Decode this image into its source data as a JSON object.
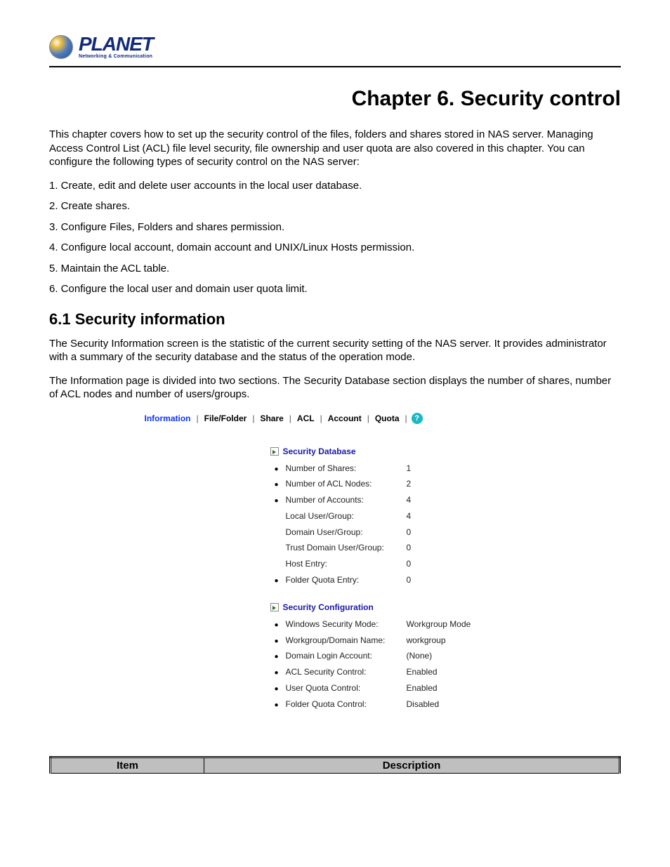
{
  "logo": {
    "brand": "PLANET",
    "tagline": "Networking & Communication"
  },
  "chapter_title": "Chapter 6.  Security control",
  "intro_paragraph": "This chapter covers how to set up the security control of the files, folders and shares stored in NAS server. Managing Access Control List (ACL) file level security, file ownership and user quota are also covered in this chapter. You can configure the following types of security control on the NAS server:",
  "numbered_list": [
    "1. Create, edit and delete user accounts in the local user database.",
    "2. Create shares.",
    "3. Configure Files, Folders and shares permission.",
    "4. Configure local account, domain account and UNIX/Linux Hosts permission.",
    "5. Maintain the ACL table.",
    "6. Configure the local user and domain user quota limit."
  ],
  "section_heading": "6.1 Security information",
  "section_p1": "The Security Information screen is the statistic of the current security setting of the NAS server. It provides administrator with a summary of the security database and the status of the operation mode.",
  "section_p2": "The Information page is divided into two sections. The Security Database section displays the number of shares, number of ACL nodes and number of users/groups.",
  "screenshot": {
    "tabs": [
      "Information",
      "File/Folder",
      "Share",
      "ACL",
      "Account",
      "Quota"
    ],
    "active_tab_index": 0,
    "groups": [
      {
        "title": "Security Database",
        "rows": [
          {
            "bullet": true,
            "key": "Number of Shares:",
            "val": "1"
          },
          {
            "bullet": true,
            "key": "Number of ACL Nodes:",
            "val": "2"
          },
          {
            "bullet": true,
            "key": "Number of Accounts:",
            "val": "4"
          },
          {
            "bullet": false,
            "key": "Local User/Group:",
            "val": "4"
          },
          {
            "bullet": false,
            "key": "Domain User/Group:",
            "val": "0"
          },
          {
            "bullet": false,
            "key": "Trust Domain User/Group:",
            "val": "0"
          },
          {
            "bullet": false,
            "key": "Host Entry:",
            "val": "0"
          },
          {
            "bullet": true,
            "key": "Folder Quota Entry:",
            "val": "0"
          }
        ]
      },
      {
        "title": "Security Configuration",
        "rows": [
          {
            "bullet": true,
            "key": "Windows Security Mode:",
            "val": "Workgroup Mode"
          },
          {
            "bullet": true,
            "key": "Workgroup/Domain Name:",
            "val": "workgroup"
          },
          {
            "bullet": true,
            "key": "Domain Login Account:",
            "val": "(None)"
          },
          {
            "bullet": true,
            "key": "ACL Security Control:",
            "val": "Enabled"
          },
          {
            "bullet": true,
            "key": "User Quota Control:",
            "val": "Enabled"
          },
          {
            "bullet": true,
            "key": "Folder Quota Control:",
            "val": "Disabled"
          }
        ]
      }
    ]
  },
  "table_headers": {
    "col1": "Item",
    "col2": "Description"
  }
}
